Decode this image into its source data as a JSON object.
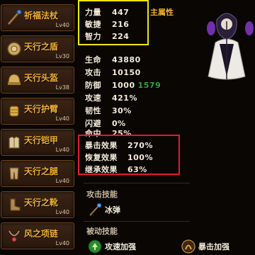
{
  "equipment": [
    {
      "name": "祈福法杖",
      "level": "Lv40",
      "icon": "staff-icon"
    },
    {
      "name": "天行之盾",
      "level": "Lv30",
      "icon": "shield-icon"
    },
    {
      "name": "天行头盔",
      "level": "Lv38",
      "icon": "helmet-icon"
    },
    {
      "name": "天行护臂",
      "level": "Lv40",
      "icon": "bracer-icon"
    },
    {
      "name": "天行铠甲",
      "level": "Lv40",
      "icon": "armor-icon"
    },
    {
      "name": "天行之腿",
      "level": "Lv40",
      "icon": "leggings-icon"
    },
    {
      "name": "天行之靴",
      "level": "Lv40",
      "icon": "boots-icon"
    },
    {
      "name": "风之项链",
      "level": "Lv40",
      "icon": "necklace-icon"
    }
  ],
  "primary_stats": [
    {
      "label": "力量",
      "value": "447"
    },
    {
      "label": "敏捷",
      "value": "216"
    },
    {
      "label": "智力",
      "value": "224"
    }
  ],
  "main_attribute_label": "主属性",
  "combat_stats": [
    {
      "label": "生命",
      "value": "43880",
      "bonus": ""
    },
    {
      "label": "攻击",
      "value": "10150",
      "bonus": ""
    },
    {
      "label": "防御",
      "value": "1000",
      "bonus": "1579"
    },
    {
      "label": "攻速",
      "value": "421%",
      "bonus": ""
    },
    {
      "label": "韧性",
      "value": "30%",
      "bonus": ""
    },
    {
      "label": "闪避",
      "value": "0%",
      "bonus": ""
    },
    {
      "label": "命中",
      "value": "25%",
      "bonus": ""
    }
  ],
  "special_stats": [
    {
      "label": "暴击效果",
      "value": "270%"
    },
    {
      "label": "恢复效果",
      "value": "100%"
    },
    {
      "label": "继承效果",
      "value": "63%"
    }
  ],
  "attack_skills_title": "攻击技能",
  "attack_skills": [
    {
      "name": "冰弹",
      "icon": "ice-staff-icon"
    }
  ],
  "passive_skills_title": "被动技能",
  "passive_skills": [
    {
      "name": "攻速加强",
      "icon": "speed-up-icon"
    },
    {
      "name": "暴击加强",
      "icon": "critical-up-icon"
    }
  ],
  "colors": {
    "gold": "#f0b030",
    "highlight_yellow": "#f2e60a",
    "highlight_red": "#e51a2a",
    "bonus_green": "#3aa040"
  }
}
